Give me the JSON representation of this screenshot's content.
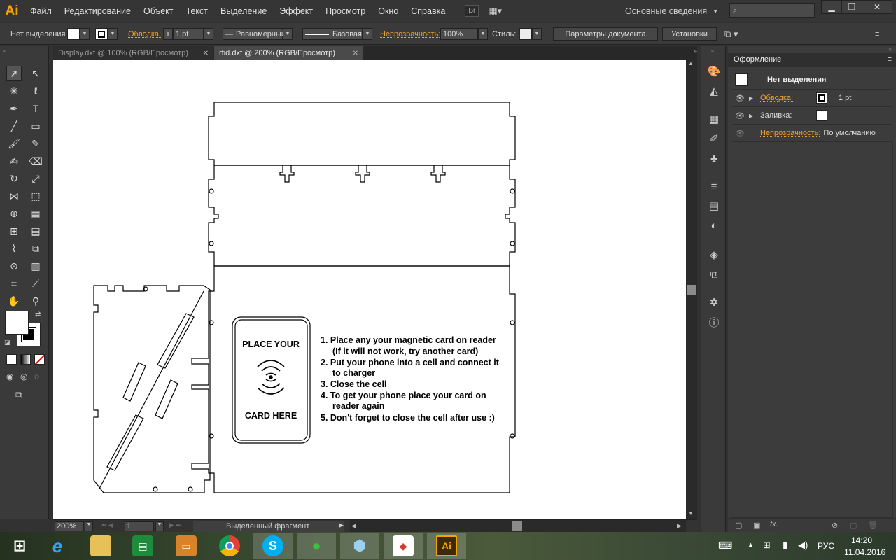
{
  "app": {
    "logo": "Ai",
    "accent": "#f7a300"
  },
  "menu": [
    "Файл",
    "Редактирование",
    "Объект",
    "Текст",
    "Выделение",
    "Эффект",
    "Просмотр",
    "Окно",
    "Справка"
  ],
  "menubar": {
    "bridge_label": "Br",
    "workspace": "Основные сведения",
    "search_placeholder": ""
  },
  "control": {
    "selection": "Нет выделения",
    "stroke_label": "Обводка:",
    "stroke_weight": "1 pt",
    "profile": "Равномерный",
    "brush": "Базовая",
    "opacity_label": "Непрозрачность:",
    "opacity_value": "100%",
    "style_label": "Стиль:",
    "doc_settings": "Параметры документа",
    "preferences": "Установки"
  },
  "tabs": [
    {
      "label": "Display.dxf @ 100% (RGB/Просмотр)",
      "close": "✕"
    },
    {
      "label": "rfid.dxf @ 200% (RGB/Просмотр)",
      "close": "✕"
    }
  ],
  "artwork": {
    "card_top": "PLACE YOUR",
    "card_bottom": "CARD HERE",
    "instructions": [
      "1. Place any your magnetic card on reader",
      "(If it will not work, try another card)",
      "2. Put your phone into a cell and connect it",
      "to charger",
      "3. Close the cell",
      "4. To get your phone place your card on",
      "reader again",
      "5. Don't forget to close the cell after use :)"
    ]
  },
  "status": {
    "zoom": "200%",
    "artboard": "1",
    "mode": "Выделенный фрагмент"
  },
  "appearance": {
    "title": "Оформление",
    "selection": "Нет выделения",
    "stroke_label": "Обводка:",
    "stroke_value": "1 pt",
    "fill_label": "Заливка:",
    "opacity_label": "Непрозрачность:",
    "opacity_value": "По умолчанию"
  },
  "taskbar": {
    "apps": [
      "start",
      "internet-explorer",
      "file-explorer",
      "excel",
      "powerpoint",
      "chrome",
      "skype",
      "green-app",
      "3d-box",
      "sketchup",
      "illustrator"
    ],
    "illustrator_label": "Ai",
    "lang": "РУС",
    "time": "14:20",
    "date": "11.04.2016"
  }
}
